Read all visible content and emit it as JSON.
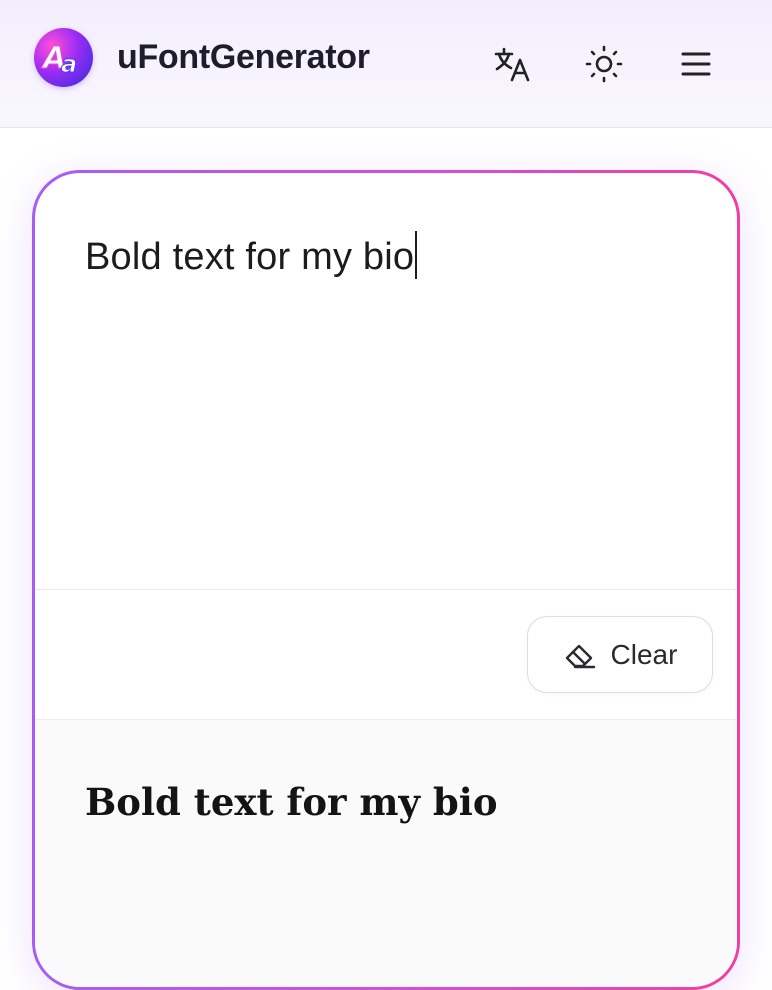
{
  "header": {
    "logo_icon": "aa-font-logo-icon",
    "brand": "uFontGenerator",
    "actions": [
      {
        "icon": "translate-icon"
      },
      {
        "icon": "sun-icon"
      },
      {
        "icon": "hamburger-menu-icon"
      }
    ]
  },
  "editor": {
    "input_value": "Bold text for my bio",
    "clear_label": "Clear",
    "clear_icon": "eraser-icon"
  },
  "result": {
    "text": "Bold text for my bio"
  },
  "colors": {
    "border_gradient_start": "#a45ef5",
    "border_gradient_end": "#ef3f9f",
    "header_bg": "#f3eefd"
  }
}
